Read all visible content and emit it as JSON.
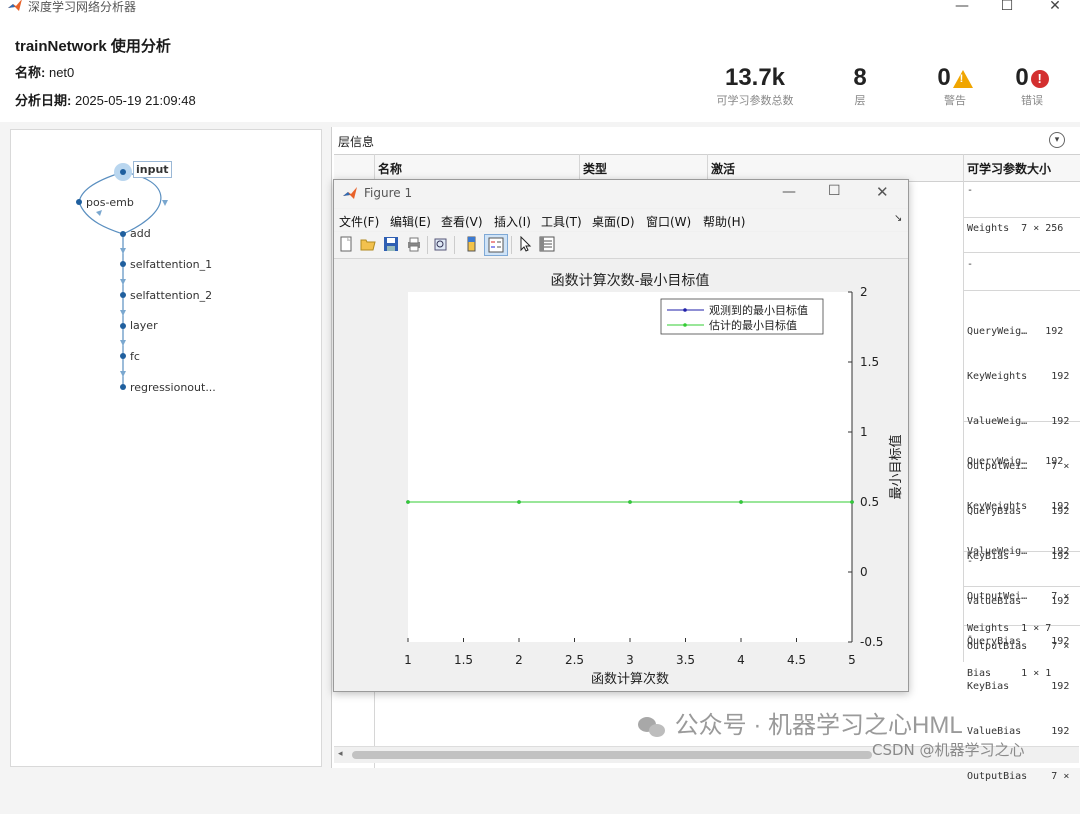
{
  "window": {
    "title": "深度学习网络分析器"
  },
  "header": {
    "title": "trainNetwork 使用分析",
    "name_label": "名称:",
    "name_value": "net0",
    "date_label": "分析日期:",
    "date_value": "2025-05-19 21:09:48"
  },
  "stats": [
    {
      "value": "13.7k",
      "label": "可学习参数总数"
    },
    {
      "value": "8",
      "label": "层"
    },
    {
      "value": "0",
      "label": "警告"
    },
    {
      "value": "0",
      "label": "错误"
    }
  ],
  "graph": {
    "nodes": [
      "input",
      "pos-emb",
      "add",
      "selfattention_1",
      "selfattention_2",
      "layer",
      "fc",
      "regressionout..."
    ]
  },
  "table": {
    "title": "层信息",
    "headers": {
      "name": "名称",
      "type": "类型",
      "activation": "激活",
      "params": "可学习参数大小"
    },
    "rows": [
      {
        "params": [
          "-"
        ]
      },
      {
        "params": [
          "Weights  7 × 256"
        ]
      },
      {
        "params": [
          "-"
        ]
      },
      {
        "params": [
          "QueryWeig…   192",
          "KeyWeights    192",
          "ValueWeig…    192",
          "OutputWei…    7 ×",
          "QueryBias     192",
          "KeyBias       192",
          "ValueBias     192",
          "OutputBias    7 ×"
        ]
      },
      {
        "params": [
          "QueryWeig…   192",
          "KeyWeights    192",
          "ValueWeig…    192",
          "OutputWei…    7 ×",
          "QueryBias     192",
          "KeyBias       192",
          "ValueBias     192",
          "OutputBias    7 ×"
        ]
      },
      {
        "params": [
          "-"
        ]
      },
      {
        "params": [
          "Weights  1 × 7",
          "Bias     1 × 1"
        ]
      },
      {
        "params": [
          "-"
        ]
      }
    ]
  },
  "figure": {
    "title": "Figure 1",
    "menus": [
      "文件(F)",
      "编辑(E)",
      "查看(V)",
      "插入(I)",
      "工具(T)",
      "桌面(D)",
      "窗口(W)",
      "帮助(H)"
    ]
  },
  "chart_data": {
    "type": "line",
    "title": "函数计算次数-最小目标值",
    "xlabel": "函数计算次数",
    "ylabel": "最小目标值",
    "xlim": [
      1,
      5
    ],
    "ylim": [
      -0.5,
      2
    ],
    "xticks": [
      "1",
      "1.5",
      "2",
      "2.5",
      "3",
      "3.5",
      "4",
      "4.5",
      "5"
    ],
    "yticks": [
      "2",
      "1.5",
      "1",
      "0.5",
      "0",
      "-0.5"
    ],
    "y_axis_side": "right",
    "legend_position": "top-right",
    "grid": false,
    "series": [
      {
        "name": "观测到的最小目标值",
        "color": "#1f1fa8",
        "x": [
          1,
          2,
          3,
          4,
          5
        ],
        "y": [
          0.5,
          0.5,
          0.5,
          0.5,
          0.5
        ]
      },
      {
        "name": "估计的最小目标值",
        "color": "#33cc33",
        "x": [
          1,
          2,
          3,
          4,
          5
        ],
        "y": [
          0.5,
          0.5,
          0.5,
          0.5,
          0.5
        ]
      }
    ]
  },
  "watermark": {
    "main": "公众号 · 机器学习之心HML",
    "sub": "CSDN @机器学习之心"
  }
}
